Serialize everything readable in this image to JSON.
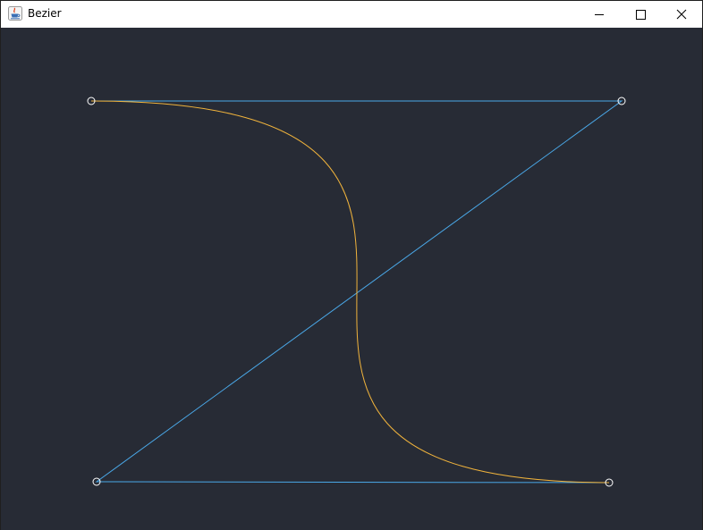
{
  "window": {
    "title": "Bezier",
    "app_icon": "java-cup-icon",
    "controls": [
      "minimize-icon",
      "maximize-icon",
      "close-icon"
    ]
  },
  "canvas": {
    "background_color": "#272b35",
    "polygon_color": "#4aa8e8",
    "curve_color": "#f0b33c",
    "control_point_color": "#ffffff"
  }
}
